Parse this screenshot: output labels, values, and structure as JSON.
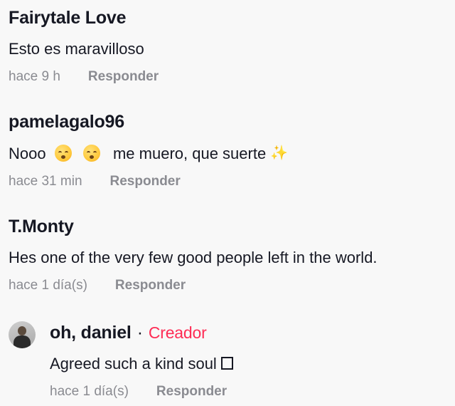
{
  "comments": [
    {
      "username": "Fairytale Love",
      "text": "Esto es maravilloso",
      "time": "hace 9 h",
      "reply_label": "Responder"
    },
    {
      "username": "pamelagalo96",
      "text_before": "Nooo",
      "text_after": "me muero, que suerte",
      "emojis": [
        "hushed-face-emoji",
        "hushed-face-emoji",
        "sparkles-emoji"
      ],
      "time": "hace 31 min",
      "reply_label": "Responder"
    },
    {
      "username": "T.Monty",
      "text": "Hes one of the very few good people left in the world.",
      "time": "hace 1 día(s)",
      "reply_label": "Responder"
    }
  ],
  "reply": {
    "username": "oh, daniel",
    "separator": "·",
    "badge": "Creador",
    "text": "Agreed such a kind soul",
    "time": "hace 1 día(s)",
    "reply_label": "Responder",
    "avatar_icon": "user-avatar"
  },
  "colors": {
    "background": "#f8f8f8",
    "text": "#161823",
    "muted": "#8a8b91",
    "creator_badge": "#fe2c55"
  }
}
